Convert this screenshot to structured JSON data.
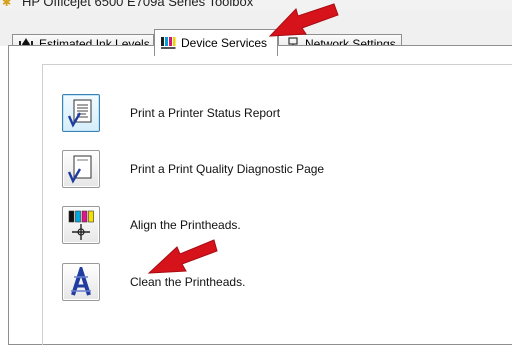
{
  "window": {
    "title": "HP Officejet 6500 E709a Series Toolbox"
  },
  "tabs": [
    {
      "label": "Estimated Ink Levels",
      "icon": "ink-drop-icon",
      "active": false
    },
    {
      "label": "Device Services",
      "icon": "ink-cartridges-icon",
      "active": true
    },
    {
      "label": "Network Settings",
      "icon": "network-icon",
      "active": false
    }
  ],
  "actions": [
    {
      "label": "Print a Printer Status Report",
      "icon": "status-report-icon"
    },
    {
      "label": "Print a Print Quality Diagnostic Page",
      "icon": "diagnostic-page-icon"
    },
    {
      "label": "Align the Printheads.",
      "icon": "align-printheads-icon"
    },
    {
      "label": "Clean the Printheads.",
      "icon": "clean-printheads-icon"
    }
  ],
  "annotations": [
    {
      "icon": "red-arrow-icon",
      "points_to": "Device Services"
    },
    {
      "icon": "red-arrow-icon",
      "points_to": "Clean the Printheads."
    }
  ],
  "colors": {
    "arrow": "#d6121b",
    "tab_border": "#8e8f8f",
    "icon_blue": "#1f3c9e"
  }
}
